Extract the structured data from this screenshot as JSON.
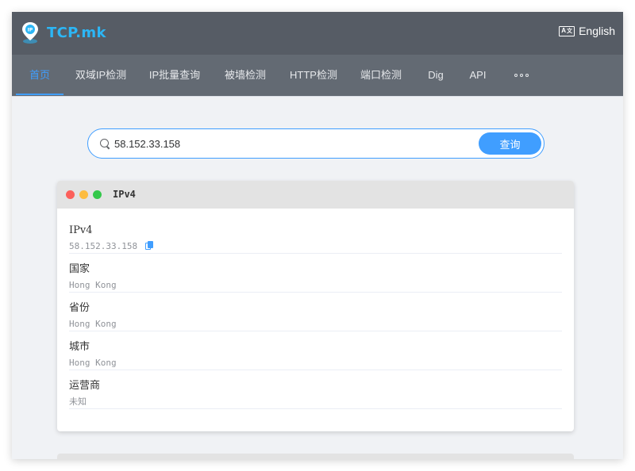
{
  "app": {
    "title": "TCP.mk",
    "language_label": "English",
    "language_icon_text": "A"
  },
  "nav": {
    "items": [
      {
        "label": "首页",
        "active": true
      },
      {
        "label": "双域IP检测"
      },
      {
        "label": "IP批量查询"
      },
      {
        "label": "被墙检测"
      },
      {
        "label": "HTTP检测"
      },
      {
        "label": "端口检测"
      },
      {
        "label": "Dig"
      },
      {
        "label": "API"
      }
    ]
  },
  "search": {
    "value": "58.152.33.158",
    "button_label": "查询"
  },
  "result": {
    "title": "IPv4",
    "rows": [
      {
        "label": "IPv4",
        "value": "58.152.33.158"
      },
      {
        "label": "国家",
        "value": "Hong Kong"
      },
      {
        "label": "省份",
        "value": "Hong Kong"
      },
      {
        "label": "城市",
        "value": "Hong Kong"
      },
      {
        "label": "运营商",
        "value": "未知"
      }
    ]
  },
  "colors": {
    "accent": "#409eff",
    "topbar": "#565c65",
    "navbar": "#636a73",
    "logo_text": "#2cb6f5"
  }
}
